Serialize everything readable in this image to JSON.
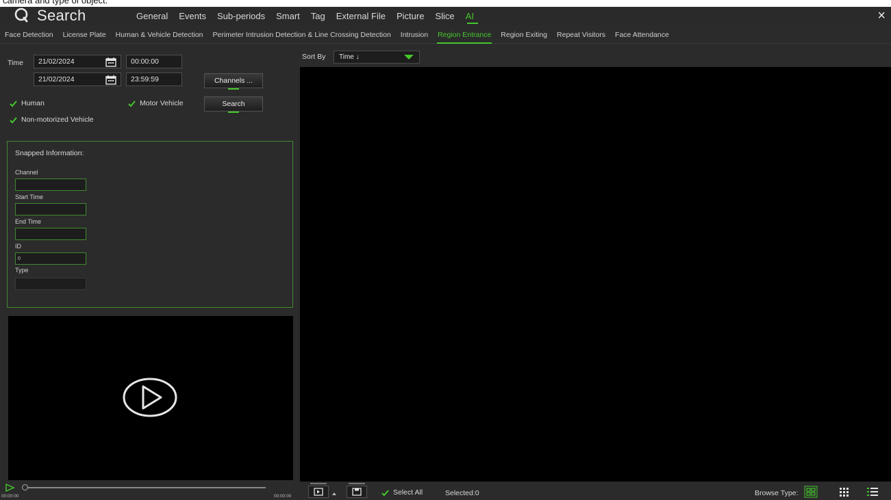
{
  "caption": "camera and type of object.",
  "header": {
    "title": "Search",
    "main_tabs": [
      "General",
      "Events",
      "Sub-periods",
      "Smart",
      "Tag",
      "External File",
      "Picture",
      "Slice",
      "AI"
    ],
    "active_main_tab": "AI",
    "close_label": "×"
  },
  "sub_tabs": {
    "items": [
      "Face Detection",
      "License Plate",
      "Human & Vehicle Detection",
      "Perimeter Intrusion Detection & Line Crossing Detection",
      "Intrusion",
      "Region Entrance",
      "Region Exiting",
      "Repeat Visitors",
      "Face Attendance"
    ],
    "active": "Region Entrance"
  },
  "filters": {
    "time_label": "Time",
    "start_date": "21/02/2024",
    "start_time": "00:00:00",
    "end_date": "21/02/2024",
    "end_time": "23:59:59",
    "channels_button": "Channels ...",
    "search_button": "Search",
    "human_label": "Human",
    "motor_vehicle_label": "Motor Vehicle",
    "non_motorized_label": "Non-motorized Vehicle"
  },
  "snapped": {
    "title": "Snapped Information:",
    "channel_label": "Channel",
    "channel_value": "",
    "start_time_label": "Start Time",
    "start_time_value": "",
    "end_time_label": "End Time",
    "end_time_value": "",
    "id_label": "ID",
    "id_value": "0",
    "type_label": "Type",
    "type_value": ""
  },
  "playback": {
    "start_time": "00:00:00",
    "end_time": "00:00:00"
  },
  "results": {
    "sort_by_label": "Sort By",
    "sort_value": "Time ↓",
    "select_all_label": "Select All",
    "selected_text": "Selected:0",
    "browse_type_label": "Browse Type:"
  },
  "colors": {
    "accent": "#45c72d",
    "background": "#2b2b2b",
    "panel_black": "#000000"
  },
  "icons": [
    "search-icon",
    "calendar-icon",
    "check-icon",
    "play-icon",
    "close-icon",
    "grid-view-icon",
    "list-view-icon"
  ]
}
